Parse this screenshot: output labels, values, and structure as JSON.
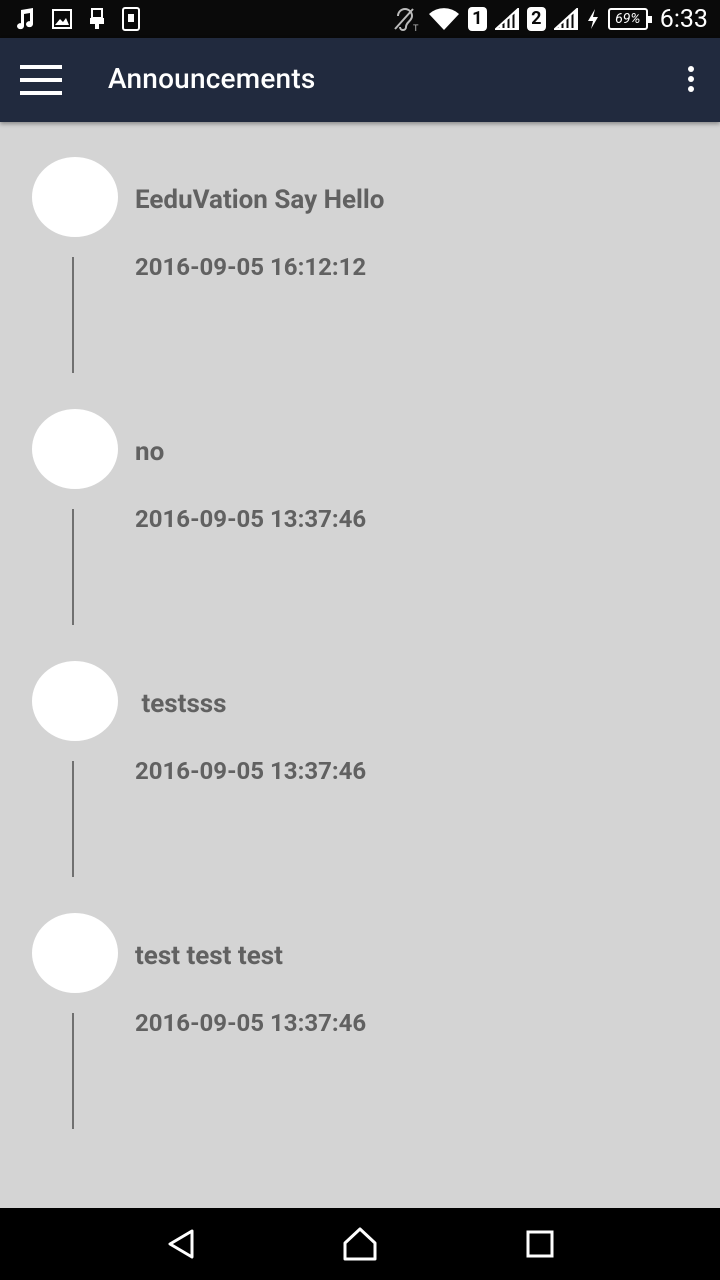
{
  "status_bar": {
    "left_icons": [
      "music-note-icon",
      "image-icon",
      "usb-icon",
      "nfc-icon"
    ],
    "right_icons": [
      "hearing-aid-icon",
      "wifi-icon",
      "signal-icon",
      "signal-icon",
      "charging-bolt-icon"
    ],
    "sim1": "1",
    "sim2": "2",
    "battery": "69%",
    "time": "6:33"
  },
  "app_bar": {
    "title": "Announcements",
    "menu_icon": "hamburger-menu-icon",
    "overflow_icon": "more-vert-icon",
    "background": "#212a3e"
  },
  "announcements": [
    {
      "title": "EeduVation Say Hello",
      "date": "2016-09-05 16:12:12"
    },
    {
      "title": "no",
      "date": "2016-09-05 13:37:46"
    },
    {
      "title": " testsss",
      "date": "2016-09-05 13:37:46"
    },
    {
      "title": "test test test",
      "date": "2016-09-05 13:37:46"
    }
  ],
  "nav_bar": {
    "back_icon": "back-triangle-icon",
    "home_icon": "home-icon",
    "recents_icon": "recents-square-icon"
  },
  "colors": {
    "background": "#d4d4d4",
    "text": "#616161",
    "avatar": "#ffffff"
  }
}
